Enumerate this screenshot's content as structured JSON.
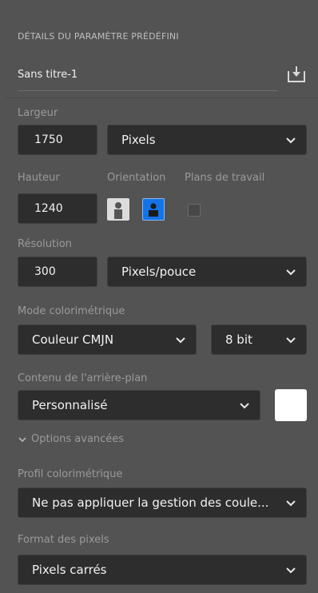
{
  "panel": {
    "section_title": "DÉTAILS DU PARAMÈTRE PRÉDÉFINI",
    "document_name": "Sans titre-1",
    "width": {
      "label": "Largeur",
      "value": "1750",
      "unit": "Pixels"
    },
    "height": {
      "label": "Hauteur",
      "value": "1240"
    },
    "orientation": {
      "label": "Orientation",
      "selected": "landscape"
    },
    "artboards": {
      "label": "Plans de travail",
      "checked": false
    },
    "resolution": {
      "label": "Résolution",
      "value": "300",
      "unit": "Pixels/pouce"
    },
    "color_mode": {
      "label": "Mode colorimétrique",
      "mode": "Couleur CMJN",
      "depth": "8 bit"
    },
    "background": {
      "label": "Contenu de l'arrière-plan",
      "value": "Personnalisé",
      "swatch_color": "#ffffff"
    },
    "advanced_toggle": "Options avancées",
    "color_profile": {
      "label": "Profil colorimétrique",
      "value": "Ne pas appliquer la gestion des coule..."
    },
    "pixel_format": {
      "label": "Format des pixels",
      "value": "Pixels carrés"
    }
  },
  "colors": {
    "panel_bg": "#535353",
    "field_bg": "#2d2d2d",
    "accent_blue": "#1473e6"
  }
}
